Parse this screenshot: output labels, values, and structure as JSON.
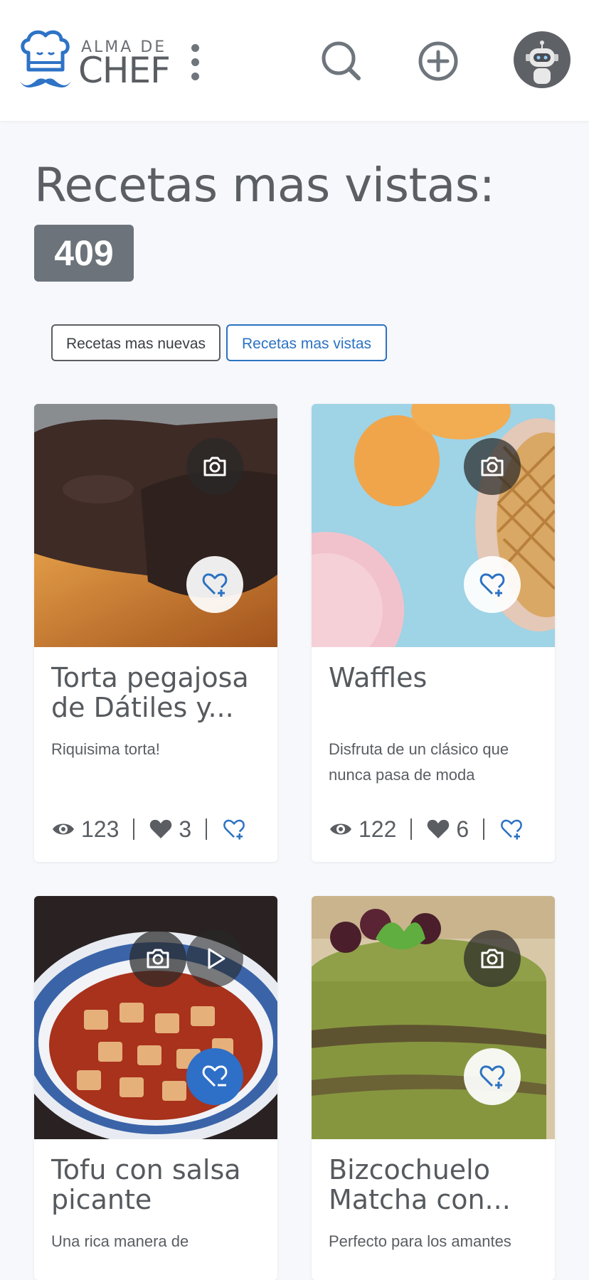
{
  "header": {
    "logo_top": "ALMA DE",
    "logo_bottom": "CHEF",
    "icons": [
      "chef-hat-logo-icon",
      "kebab-menu-icon",
      "search-icon",
      "add-circle-icon",
      "robot-avatar-icon"
    ]
  },
  "page": {
    "title": "Recetas mas vistas:",
    "count": "409"
  },
  "filters": {
    "newest_label": "Recetas mas nuevas",
    "most_viewed_label": "Recetas mas vistas",
    "active": "most_viewed"
  },
  "recipes": [
    {
      "title": "Torta pegajosa de Dátiles y...",
      "description": "Riquisima torta!",
      "views": "123",
      "likes": "3",
      "has_photo": true,
      "has_video": false,
      "favorited": false
    },
    {
      "title": "Waffles",
      "description": "Disfruta de un clásico que nunca pasa de moda",
      "views": "122",
      "likes": "6",
      "has_photo": true,
      "has_video": false,
      "favorited": false
    },
    {
      "title": "Tofu con salsa picante",
      "description": "Una rica manera de",
      "has_photo": true,
      "has_video": true,
      "favorited": true
    },
    {
      "title": "Bizcochuelo Matcha con...",
      "description": "Perfecto para los amantes",
      "has_photo": true,
      "has_video": false,
      "favorited": false
    }
  ],
  "colors": {
    "accent": "#2b72c2",
    "badge": "#6c737b",
    "background": "#f7f8fb"
  }
}
